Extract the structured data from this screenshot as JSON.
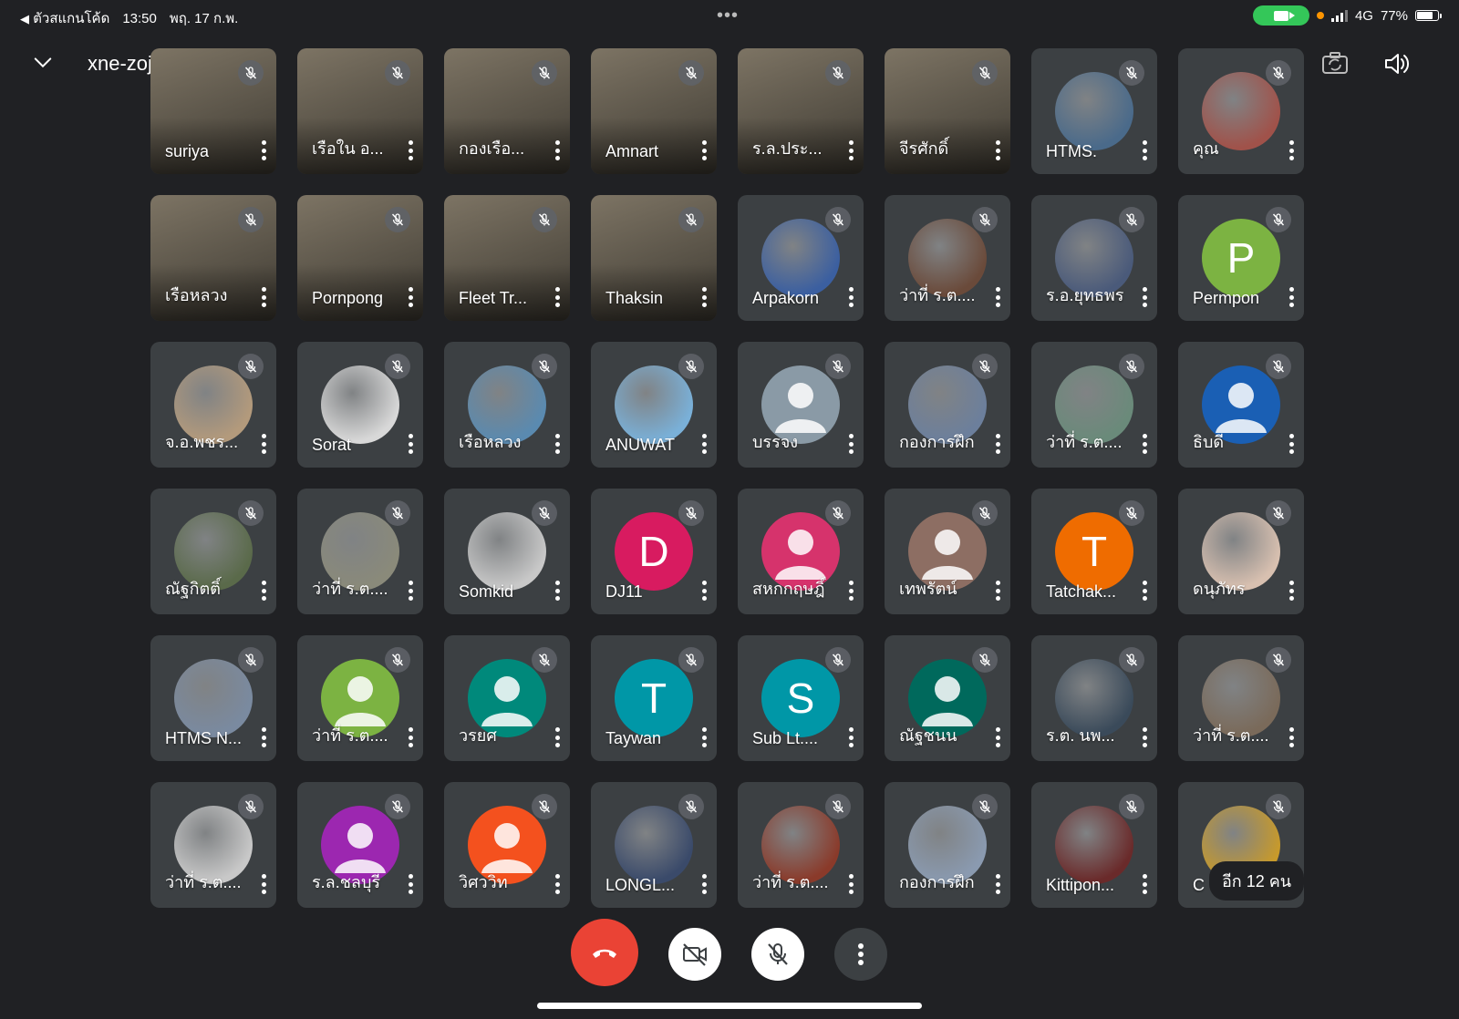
{
  "status_bar": {
    "back_label": "ตัวสแกนโค้ด",
    "time": "13:50",
    "date": "พฤ. 17 ก.พ.",
    "dots": "•••",
    "network": "4G",
    "battery": "77%",
    "battery_level": 0.77
  },
  "header": {
    "meeting_code": "xne-zojb-vod",
    "icons": [
      "chevron-down-icon",
      "switch-camera-icon",
      "speaker-icon"
    ]
  },
  "participants": [
    {
      "name": "suriya",
      "kind": "video"
    },
    {
      "name": "เรือใน อ...",
      "kind": "video"
    },
    {
      "name": "กองเรือ...",
      "kind": "video"
    },
    {
      "name": "Amnart",
      "kind": "video"
    },
    {
      "name": "ร.ล.ประ...",
      "kind": "video"
    },
    {
      "name": "จีรศักดิ์",
      "kind": "video"
    },
    {
      "name": "HTMS.",
      "kind": "photo",
      "color": "#4a6a8a"
    },
    {
      "name": "คุณ",
      "kind": "photo",
      "color": "#a0524a"
    },
    {
      "name": "เรือหลวง",
      "kind": "video"
    },
    {
      "name": "Pornpong",
      "kind": "video"
    },
    {
      "name": "Fleet Tr...",
      "kind": "video"
    },
    {
      "name": "Thaksin",
      "kind": "video"
    },
    {
      "name": "Arpakorn",
      "kind": "photo",
      "color": "#3b5fa0"
    },
    {
      "name": "ว่าที่ ร.ต....",
      "kind": "photo",
      "color": "#6a4a3a"
    },
    {
      "name": "ร.อ.ยุทธพร",
      "kind": "photo",
      "color": "#4a5a7a"
    },
    {
      "name": "Permpon",
      "kind": "letter",
      "letter": "P",
      "color": "#7cb342"
    },
    {
      "name": "จ.อ.พชร...",
      "kind": "photo",
      "color": "#b39a7c"
    },
    {
      "name": "Sorat",
      "kind": "photo",
      "color": "#d8d8d8"
    },
    {
      "name": "เรือหลวง",
      "kind": "photo",
      "color": "#5a8ab0"
    },
    {
      "name": "ANUWAT",
      "kind": "photo",
      "color": "#7ab0d8"
    },
    {
      "name": "บรรจง",
      "kind": "default",
      "color": "#8a9aa6"
    },
    {
      "name": "กองการฝึก",
      "kind": "photo",
      "color": "#6c7f9c"
    },
    {
      "name": "ว่าที่ ร.ต....",
      "kind": "photo",
      "color": "#6a8a7a"
    },
    {
      "name": "ธิบดี",
      "kind": "default",
      "color": "#1a5fb4"
    },
    {
      "name": "ณัฐกิตติ์",
      "kind": "photo",
      "color": "#5a6a4a"
    },
    {
      "name": "ว่าที่ ร.ต....",
      "kind": "photo",
      "color": "#8a8a7a"
    },
    {
      "name": "Somkid",
      "kind": "photo",
      "color": "#c8c8c8"
    },
    {
      "name": "DJ11",
      "kind": "letter",
      "letter": "D",
      "color": "#d81b60"
    },
    {
      "name": "สหกกฤษฎิ์",
      "kind": "default",
      "color": "#d6336c"
    },
    {
      "name": "เทพรัตน์",
      "kind": "default",
      "color": "#8d6e63"
    },
    {
      "name": "Tatchak...",
      "kind": "letter",
      "letter": "T",
      "color": "#ef6c00"
    },
    {
      "name": "ดนุภัทร",
      "kind": "photo",
      "color": "#d8c0b0"
    },
    {
      "name": "HTMS N...",
      "kind": "photo",
      "color": "#7a8aa0"
    },
    {
      "name": "ว่าที่ ร.ต....",
      "kind": "default",
      "color": "#7cb342"
    },
    {
      "name": "วรยศ",
      "kind": "default",
      "color": "#00897b"
    },
    {
      "name": "Taywan",
      "kind": "letter",
      "letter": "T",
      "color": "#0097a7"
    },
    {
      "name": "Sub Lt....",
      "kind": "letter",
      "letter": "S",
      "color": "#0097a7"
    },
    {
      "name": "ณัฐชนน",
      "kind": "default",
      "color": "#00695c"
    },
    {
      "name": "ร.ต. นพ...",
      "kind": "photo",
      "color": "#3a4a5a"
    },
    {
      "name": "ว่าที่ ร.ต....",
      "kind": "photo",
      "color": "#7a6a5a"
    },
    {
      "name": "ว่าที่ ร.ต....",
      "kind": "photo",
      "color": "#c8c8c8"
    },
    {
      "name": "ร.ล.ชลบุรี",
      "kind": "default",
      "color": "#9c27b0"
    },
    {
      "name": "วิศววิท",
      "kind": "default",
      "color": "#f4511e"
    },
    {
      "name": "LONGL...",
      "kind": "photo",
      "color": "#3a4a6a"
    },
    {
      "name": "ว่าที่ ร.ต....",
      "kind": "photo",
      "color": "#8a3a2a"
    },
    {
      "name": "กองการฝึก",
      "kind": "photo",
      "color": "#8a9ab0"
    },
    {
      "name": "Kittipon...",
      "kind": "photo",
      "color": "#6a2a2a"
    },
    {
      "name": "C",
      "kind": "photo",
      "color": "#c89a2a",
      "overflow_label": "อีก 12 คน"
    }
  ],
  "controls": {
    "icons": [
      "hang-up-icon",
      "camera-off-icon",
      "mic-off-icon",
      "more-options-icon"
    ]
  }
}
